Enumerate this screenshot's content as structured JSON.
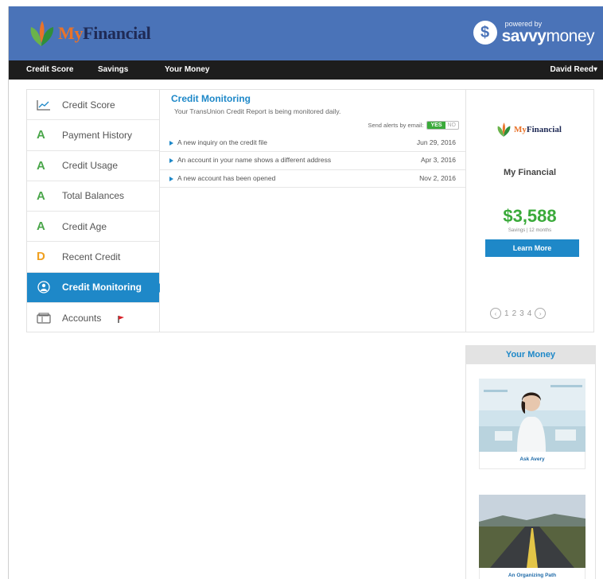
{
  "brand": {
    "logo_my": "My",
    "logo_financial": "Financial",
    "powered_by": "powered by",
    "partner_savvy": "savvy",
    "partner_money": "money"
  },
  "topnav": {
    "items": [
      "Credit Score",
      "Savings",
      "Your Money"
    ],
    "user": "David Reed▾"
  },
  "sidemenu": {
    "items": [
      {
        "label": "Credit Score",
        "icon": "chart-line-icon"
      },
      {
        "label": "Payment History",
        "grade": "A"
      },
      {
        "label": "Credit Usage",
        "grade": "A"
      },
      {
        "label": "Total Balances",
        "grade": "A"
      },
      {
        "label": "Credit Age",
        "grade": "A"
      },
      {
        "label": "Recent Credit",
        "grade": "D"
      },
      {
        "label": "Credit Monitoring",
        "icon": "shield-person-icon",
        "active": true
      },
      {
        "label": "Accounts",
        "icon": "wallet-icon",
        "flag": "red-flag-icon"
      }
    ]
  },
  "monitoring": {
    "title": "Credit Monitoring",
    "subtitle": "Your TransUnion Credit Report is being monitored daily.",
    "alerts_label": "Send alerts by email:",
    "toggle_yes": "YES",
    "toggle_no": "NO",
    "events": [
      {
        "text": "A new inquiry on the credit file",
        "date": "Jun 29, 2016"
      },
      {
        "text": "An account in your name shows a different address",
        "date": "Apr 3, 2016"
      },
      {
        "text": "A new account has been opened",
        "date": "Nov 2, 2016"
      }
    ]
  },
  "promo": {
    "logo_my": "My",
    "logo_financial": "Financial",
    "name": "My Financial",
    "amount": "$3,588",
    "caption": "Savings | 12 months",
    "button": "Learn More",
    "pages": [
      "1",
      "2",
      "3",
      "4"
    ],
    "prev": "‹",
    "next": "›"
  },
  "your_money": {
    "title": "Your Money",
    "articles": [
      {
        "caption": "Ask Avery"
      },
      {
        "caption": "An Organizing Path"
      }
    ]
  },
  "colors": {
    "header": "#4a73b8",
    "nav": "#1d1d1d",
    "accent": "#1e88c8",
    "grade_a": "#4aa64a",
    "grade_d": "#f0a020"
  }
}
